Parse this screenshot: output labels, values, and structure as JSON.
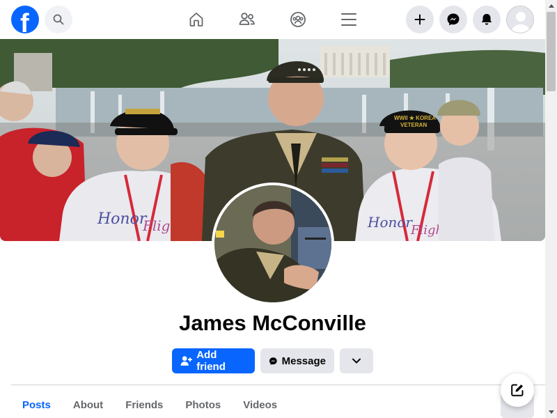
{
  "nav": {
    "logo_letter": "f",
    "icons": [
      "search-icon",
      "home-icon",
      "friends-icon",
      "groups-icon",
      "menu-icon",
      "plus-icon",
      "messenger-icon",
      "bell-icon",
      "account-avatar"
    ]
  },
  "profile": {
    "name": "James McConville"
  },
  "actions": {
    "add_friend_label": "Add friend",
    "message_label": "Message"
  },
  "tabs": [
    {
      "label": "Posts",
      "active": true
    },
    {
      "label": "About",
      "active": false
    },
    {
      "label": "Friends",
      "active": false
    },
    {
      "label": "Photos",
      "active": false
    },
    {
      "label": "Videos",
      "active": false
    }
  ],
  "colors": {
    "brand": "#0866ff",
    "button_gray": "#e4e6eb",
    "text_secondary": "#65676b"
  }
}
